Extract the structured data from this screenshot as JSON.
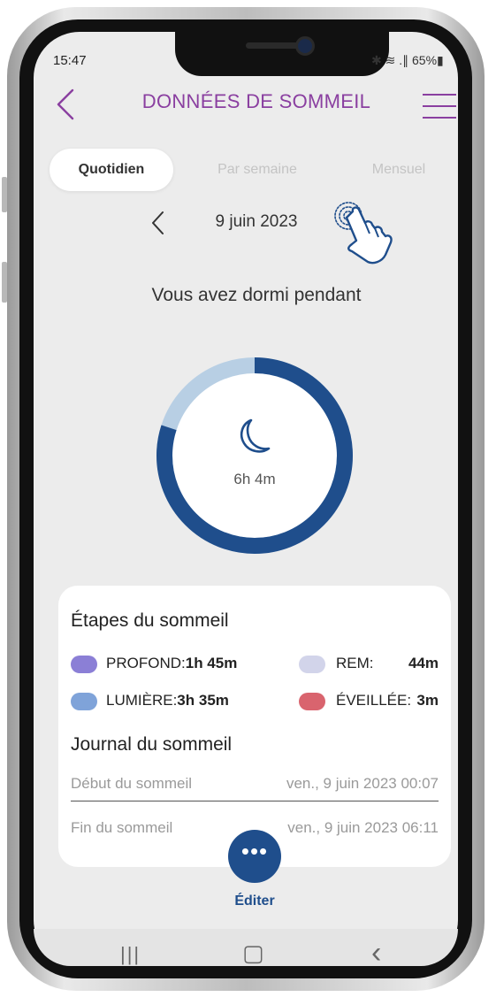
{
  "status_bar": {
    "time": "15:47",
    "right": "✱ ≋ .∥ 65%▮"
  },
  "header": {
    "title": "DONNÉES DE SOMMEIL",
    "back_icon": "chevron-left-icon",
    "menu_icon": "hamburger-menu-icon",
    "accent": "#8a3fa0"
  },
  "tabs": [
    {
      "label": "Quotidien",
      "active": true
    },
    {
      "label": "Par semaine",
      "active": false
    },
    {
      "label": "Mensuel",
      "active": false
    }
  ],
  "date_nav": {
    "date": "9 juin 2023",
    "prev_icon": "chevron-left-icon",
    "hint_icon": "tap-hand-icon"
  },
  "summary": {
    "heading": "Vous avez dormi pendant",
    "duration": "6h 4m",
    "ring_fraction_dark": 0.8,
    "ring_dark_color": "#1f4e8c",
    "ring_light_color": "#b8cfe4",
    "center_icon": "moon-icon"
  },
  "stages_card": {
    "title": "Étapes du sommeil",
    "stages": [
      {
        "name": "PROFOND:",
        "value": "1h 45m",
        "color": "#8b7fd6"
      },
      {
        "name": "REM:",
        "value": "44m",
        "color": "#d2d4ea"
      },
      {
        "name": "LUMIÈRE:",
        "value": "3h 35m",
        "color": "#7fa3d9"
      },
      {
        "name": "ÉVEILLÉE:",
        "value": "3m",
        "color": "#d9646e"
      }
    ],
    "journal_title": "Journal du sommeil",
    "log": [
      {
        "label": "Début du sommeil",
        "value": "ven., 9 juin 2023 00:07"
      },
      {
        "label": "Fin du sommeil",
        "value": "ven., 9 juin 2023 06:11"
      }
    ]
  },
  "edit_button": {
    "dots": "•••",
    "label": "Éditer",
    "color": "#1f4e8c"
  },
  "android_nav": {
    "recent": "|||",
    "home": "▢",
    "back": "‹"
  }
}
